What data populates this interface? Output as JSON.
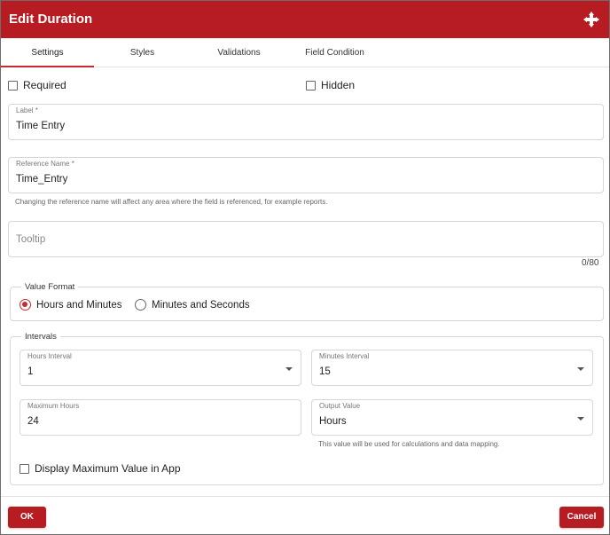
{
  "dialog": {
    "title": "Edit Duration",
    "move_icon": "move-arrows-icon"
  },
  "tabs": [
    {
      "label": "Settings",
      "active": true
    },
    {
      "label": "Styles",
      "active": false
    },
    {
      "label": "Validations",
      "active": false
    },
    {
      "label": "Field Condition",
      "active": false
    }
  ],
  "settings": {
    "required": {
      "label": "Required",
      "checked": false
    },
    "hidden": {
      "label": "Hidden",
      "checked": false
    },
    "label_field": {
      "label": "Label *",
      "value": "Time Entry"
    },
    "reference_field": {
      "label": "Reference Name *",
      "value": "Time_Entry",
      "helper": "Changing the reference name will affect any area where the field is referenced, for example reports."
    },
    "tooltip_field": {
      "placeholder": "Tooltip",
      "counter": "0/80"
    },
    "value_format": {
      "legend": "Value Format",
      "options": [
        {
          "label": "Hours and Minutes",
          "selected": true
        },
        {
          "label": "Minutes and Seconds",
          "selected": false
        }
      ]
    },
    "intervals": {
      "legend": "Intervals",
      "hours_interval": {
        "label": "Hours Interval",
        "value": "1"
      },
      "minutes_interval": {
        "label": "Minutes Interval",
        "value": "15"
      },
      "maximum_hours": {
        "label": "Maximum Hours",
        "value": "24"
      },
      "output_value": {
        "label": "Output Value",
        "value": "Hours",
        "helper": "This value will be used for calculations and data mapping."
      },
      "display_max": {
        "label": "Display Maximum Value in App",
        "checked": false
      }
    }
  },
  "footer": {
    "ok_label": "OK",
    "cancel_label": "Cancel"
  },
  "colors": {
    "brand": "#b71c23",
    "accent": "#c62a2f"
  }
}
